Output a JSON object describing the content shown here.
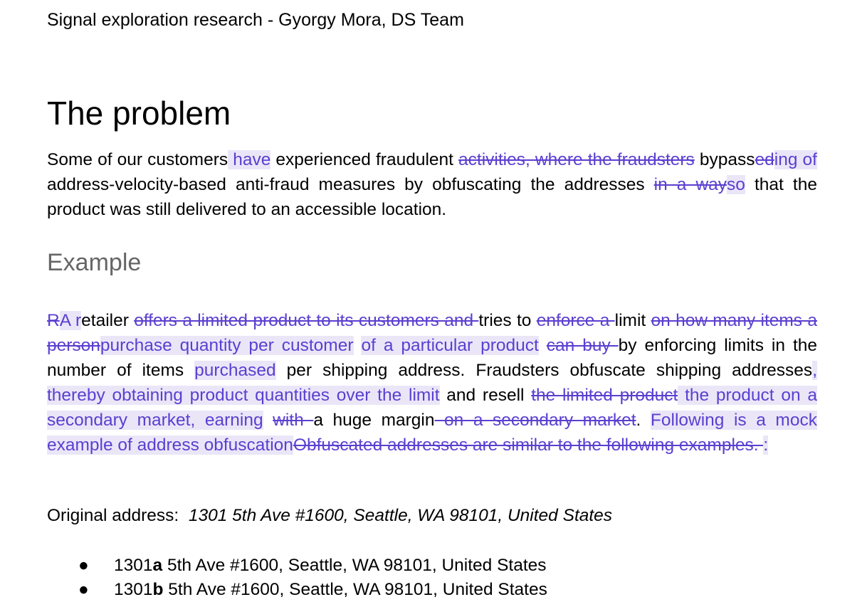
{
  "header": {
    "text": "Signal exploration research - Gyorgy Mora, DS Team"
  },
  "title": "The problem",
  "para1": [
    {
      "t": "Some of our customers",
      "k": "n"
    },
    {
      "t": " have",
      "k": "i"
    },
    {
      "t": " experienced fraudulent ",
      "k": "n"
    },
    {
      "t": "activities, where the fraudsters",
      "k": "d"
    },
    {
      "t": " bypass",
      "k": "n"
    },
    {
      "t": "ed",
      "k": "d"
    },
    {
      "t": "ing of",
      "k": "i"
    },
    {
      "t": " address-velocity-based anti-fraud measures by obfuscating the addresses ",
      "k": "n"
    },
    {
      "t": "in a way",
      "k": "d"
    },
    {
      "t": "so",
      "k": "i"
    },
    {
      "t": " that the product was still delivered to an accessible location.",
      "k": "n"
    }
  ],
  "subheading": "Example",
  "para2": [
    {
      "t": "R",
      "k": "d"
    },
    {
      "t": "A r",
      "k": "i"
    },
    {
      "t": "etailer ",
      "k": "n"
    },
    {
      "t": "offers a limited product to its customers and ",
      "k": "d"
    },
    {
      "t": "tries to ",
      "k": "n"
    },
    {
      "t": "enforce a ",
      "k": "d"
    },
    {
      "t": "limit ",
      "k": "n"
    },
    {
      "t": "on how many items a person",
      "k": "d"
    },
    {
      "t": "purchase quantity per customer",
      "k": "i"
    },
    {
      "t": " ",
      "k": "n"
    },
    {
      "t": "of a particular product",
      "k": "i"
    },
    {
      "t": " ",
      "k": "n"
    },
    {
      "t": "can buy ",
      "k": "d"
    },
    {
      "t": "by enforcing limits in the number of items ",
      "k": "n"
    },
    {
      "t": "purchased",
      "k": "i"
    },
    {
      "t": " per shipping address. Fraudsters obfuscate shipping addresses",
      "k": "n"
    },
    {
      "t": ", thereby obtaining product quantities over the limit",
      "k": "i"
    },
    {
      "t": " and resell ",
      "k": "n"
    },
    {
      "t": "the limited product",
      "k": "d"
    },
    {
      "t": " the product on a secondary market, earning",
      "k": "i"
    },
    {
      "t": " ",
      "k": "n"
    },
    {
      "t": "with ",
      "k": "d"
    },
    {
      "t": "a huge margin",
      "k": "n"
    },
    {
      "t": " on a secondary market",
      "k": "d"
    },
    {
      "t": ". ",
      "k": "n"
    },
    {
      "t": "Following is a mock example of address obfuscation",
      "k": "i"
    },
    {
      "t": "Obfuscated addresses are similar to the following examples. ",
      "k": "d"
    },
    {
      "t": ":",
      "k": "i"
    }
  ],
  "original": {
    "label": "Original address:",
    "address": "1301 5th Ave #1600, Seattle, WA 98101, United States"
  },
  "bullets": [
    {
      "pre": "1301",
      "bold": "a",
      "post": " 5th Ave #1600, Seattle, WA 98101, United States"
    },
    {
      "pre": "1301",
      "bold": "b",
      "post": " 5th Ave #1600, Seattle, WA 98101, United States"
    }
  ],
  "colors": {
    "suggestion": "#5b3fd0",
    "suggestion_bg": "#eae6f8",
    "subheading": "#666666"
  }
}
